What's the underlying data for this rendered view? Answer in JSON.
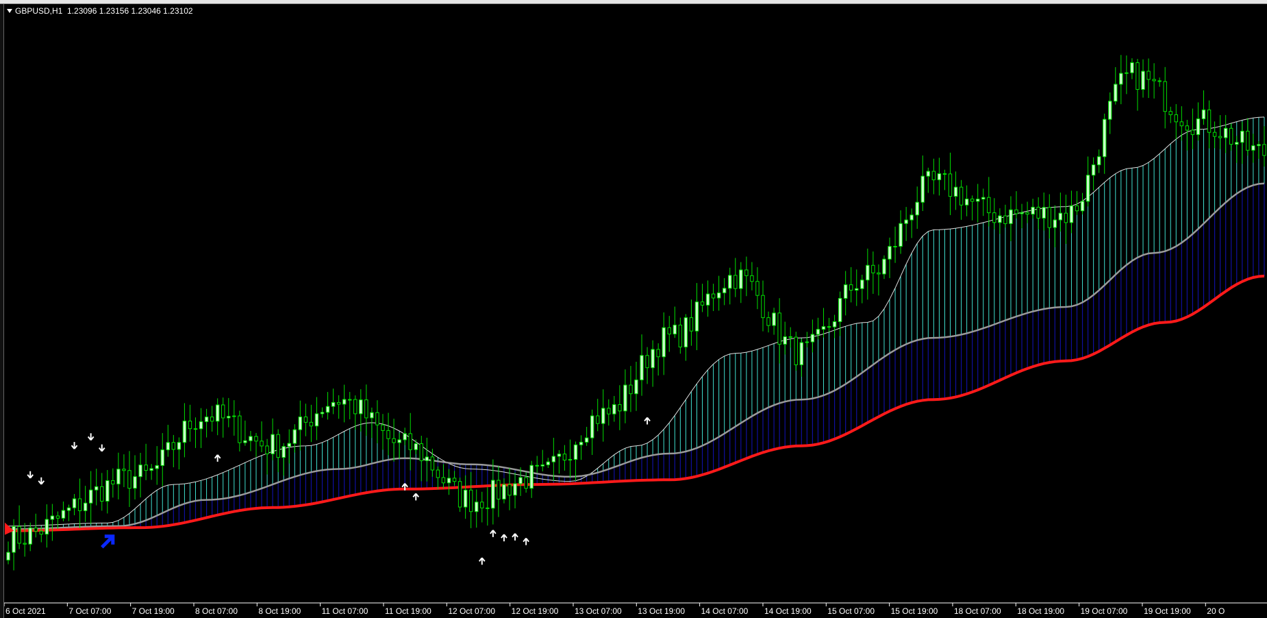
{
  "window": {
    "symbol_label": "GBPUSD,H1",
    "ohlc": "1.23096 1.23156 1.23046 1.23102"
  },
  "colors": {
    "background": "#000000",
    "bull_candle": "#c8ffc8",
    "bear_candle": "#000000",
    "wick": "#00e000",
    "fast_ma": "#e0e0e0",
    "mid_ma": "#9a9a9a",
    "slow_ma": "#ff1a1a",
    "upper_fill": "#40e0d0",
    "lower_fill": "#1010a0",
    "arrow": "#ffffff",
    "signal_arrow": "#0a28ff"
  },
  "chart_data": {
    "type": "candlestick",
    "timeframe": "H1",
    "grid": false,
    "x_ticks": [
      "6 Oct 2021",
      "7 Oct 07:00",
      "7 Oct 19:00",
      "8 Oct 07:00",
      "8 Oct 19:00",
      "11 Oct 07:00",
      "11 Oct 19:00",
      "12 Oct 07:00",
      "12 Oct 19:00",
      "13 Oct 07:00",
      "13 Oct 19:00",
      "14 Oct 07:00",
      "14 Oct 19:00",
      "15 Oct 07:00",
      "15 Oct 19:00",
      "18 Oct 07:00",
      "18 Oct 19:00",
      "19 Oct 07:00",
      "19 Oct 19:00",
      "20 O"
    ],
    "price_anchors": [
      {
        "bar": 0,
        "price": 1.356
      },
      {
        "bar": 24,
        "price": 1.36
      },
      {
        "bar": 36,
        "price": 1.364
      },
      {
        "bar": 48,
        "price": 1.362
      },
      {
        "bar": 60,
        "price": 1.365
      },
      {
        "bar": 72,
        "price": 1.362
      },
      {
        "bar": 84,
        "price": 1.3585
      },
      {
        "bar": 96,
        "price": 1.36
      },
      {
        "bar": 108,
        "price": 1.364
      },
      {
        "bar": 120,
        "price": 1.369
      },
      {
        "bar": 132,
        "price": 1.373
      },
      {
        "bar": 144,
        "price": 1.368
      },
      {
        "bar": 156,
        "price": 1.373
      },
      {
        "bar": 168,
        "price": 1.379
      },
      {
        "bar": 180,
        "price": 1.377
      },
      {
        "bar": 192,
        "price": 1.377
      },
      {
        "bar": 204,
        "price": 1.386
      },
      {
        "bar": 216,
        "price": 1.383
      },
      {
        "bar": 228,
        "price": 1.381
      }
    ],
    "fast_ma_anchors": [
      {
        "bar": 0,
        "price": 1.3568
      },
      {
        "bar": 18,
        "price": 1.357
      },
      {
        "bar": 30,
        "price": 1.3595
      },
      {
        "bar": 54,
        "price": 1.362
      },
      {
        "bar": 66,
        "price": 1.3635
      },
      {
        "bar": 84,
        "price": 1.3605
      },
      {
        "bar": 102,
        "price": 1.3597
      },
      {
        "bar": 114,
        "price": 1.362
      },
      {
        "bar": 132,
        "price": 1.368
      },
      {
        "bar": 144,
        "price": 1.369
      },
      {
        "bar": 156,
        "price": 1.37
      },
      {
        "bar": 168,
        "price": 1.376
      },
      {
        "bar": 192,
        "price": 1.3775
      },
      {
        "bar": 204,
        "price": 1.38
      },
      {
        "bar": 216,
        "price": 1.3825
      },
      {
        "bar": 228,
        "price": 1.3833
      }
    ],
    "mid_ma_anchors": [
      {
        "bar": 0,
        "price": 1.3566
      },
      {
        "bar": 20,
        "price": 1.3568
      },
      {
        "bar": 36,
        "price": 1.3585
      },
      {
        "bar": 60,
        "price": 1.3605
      },
      {
        "bar": 72,
        "price": 1.3612
      },
      {
        "bar": 84,
        "price": 1.3608
      },
      {
        "bar": 102,
        "price": 1.36
      },
      {
        "bar": 120,
        "price": 1.3615
      },
      {
        "bar": 144,
        "price": 1.365
      },
      {
        "bar": 168,
        "price": 1.369
      },
      {
        "bar": 192,
        "price": 1.371
      },
      {
        "bar": 208,
        "price": 1.3745
      },
      {
        "bar": 228,
        "price": 1.379
      }
    ],
    "slow_ma_anchors": [
      {
        "bar": 0,
        "price": 1.3565
      },
      {
        "bar": 24,
        "price": 1.3567
      },
      {
        "bar": 48,
        "price": 1.358
      },
      {
        "bar": 72,
        "price": 1.3592
      },
      {
        "bar": 96,
        "price": 1.3595
      },
      {
        "bar": 120,
        "price": 1.3598
      },
      {
        "bar": 144,
        "price": 1.362
      },
      {
        "bar": 168,
        "price": 1.365
      },
      {
        "bar": 192,
        "price": 1.3675
      },
      {
        "bar": 210,
        "price": 1.37
      },
      {
        "bar": 228,
        "price": 1.373
      }
    ],
    "up_arrow_bars": [
      38,
      72,
      74,
      86,
      88,
      90,
      92,
      94,
      116
    ],
    "down_arrow_bars": [
      4,
      6,
      12,
      15,
      17
    ],
    "signal_arrow_bar": 18,
    "bar_count": 229,
    "ylim": [
      1.352,
      1.39
    ]
  }
}
